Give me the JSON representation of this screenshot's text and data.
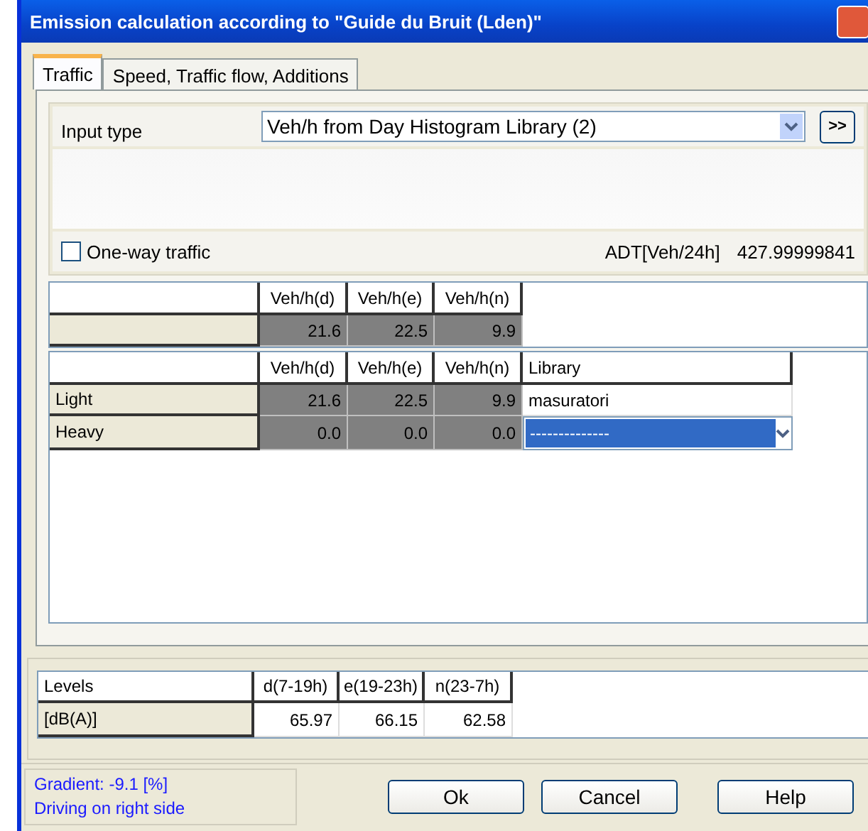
{
  "window": {
    "title": "Emission calculation according to \"Guide du Bruit (Lden)\""
  },
  "tabs": [
    {
      "label": "Traffic",
      "selected": true
    },
    {
      "label": "Speed, Traffic flow, Additions",
      "selected": false
    }
  ],
  "input_type": {
    "label": "Input type",
    "value": "Veh/h from Day Histogram Library (2)",
    "more_button": ">>"
  },
  "one_way": {
    "label": "One-way traffic",
    "checked": false
  },
  "adt": {
    "label": "ADT[Veh/24h]",
    "value": "427.99999841"
  },
  "total_table": {
    "columns": [
      "Veh/h(d)",
      "Veh/h(e)",
      "Veh/h(n)"
    ],
    "rows": [
      {
        "label": "",
        "values": [
          "21.6",
          "22.5",
          "9.9"
        ]
      }
    ]
  },
  "vehicle_table": {
    "columns": [
      "Veh/h(d)",
      "Veh/h(e)",
      "Veh/h(n)",
      "Library"
    ],
    "rows": [
      {
        "label": "Light",
        "values": [
          "21.6",
          "22.5",
          "9.9"
        ],
        "library": "masuratori",
        "selected": false
      },
      {
        "label": "Heavy",
        "values": [
          "0.0",
          "0.0",
          "0.0"
        ],
        "library": "--------------",
        "selected": true
      }
    ]
  },
  "levels_table": {
    "header": "Levels",
    "columns": [
      "d(7-19h)",
      "e(19-23h)",
      "n(23-7h)"
    ],
    "rows": [
      {
        "label": "[dB(A)]",
        "values": [
          "65.97",
          "66.15",
          "62.58"
        ]
      }
    ]
  },
  "status": [
    "Gradient: -9.1 [%]",
    "Driving on right side"
  ],
  "buttons": [
    "Ok",
    "Cancel",
    "Help"
  ]
}
